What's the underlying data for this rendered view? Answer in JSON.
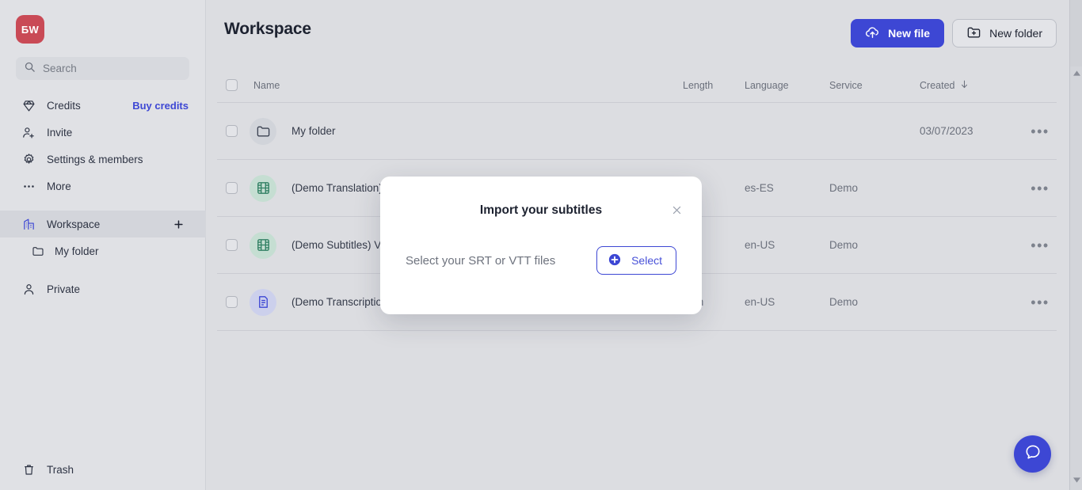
{
  "sidebar": {
    "avatar_initials": "БW",
    "search": {
      "placeholder": "Search",
      "value": ""
    },
    "items": [
      {
        "label": "Credits",
        "icon": "diamond-icon",
        "trailing": "Buy credits"
      },
      {
        "label": "Invite",
        "icon": "user-plus-icon"
      },
      {
        "label": "Settings & members",
        "icon": "gear-icon"
      },
      {
        "label": "More",
        "icon": "ellipsis-icon"
      }
    ],
    "workspace": {
      "label": "Workspace",
      "icon": "building-icon",
      "add_label": "+",
      "active": true
    },
    "workspace_child": {
      "label": "My folder",
      "icon": "folder-icon"
    },
    "private": {
      "label": "Private",
      "icon": "user-icon"
    },
    "trash": {
      "label": "Trash",
      "icon": "trash-icon"
    }
  },
  "header": {
    "title": "Workspace",
    "new_file_label": "New file",
    "new_file_icon": "cloud-upload-icon",
    "new_folder_label": "New folder",
    "new_folder_icon": "folder-plus-icon"
  },
  "table": {
    "columns": [
      "Name",
      "Length",
      "Language",
      "Service",
      "Created"
    ],
    "sort_column": "Created",
    "sort_direction": "down",
    "rows": [
      {
        "icon": "folder-icon",
        "icon_kind": "folder",
        "name": "My folder",
        "length": "",
        "language": "",
        "service": "",
        "created": "03/07/2023",
        "menu": "•••"
      },
      {
        "icon": "film-icon",
        "icon_kind": "video",
        "name": "(Demo Translation) Video",
        "length": "",
        "language": "es-ES",
        "service": "Demo",
        "created": "",
        "menu": "•••"
      },
      {
        "icon": "film-icon",
        "icon_kind": "video",
        "name": "(Demo Subtitles) Video",
        "length": "",
        "language": "en-US",
        "service": "Demo",
        "created": "",
        "menu": "•••"
      },
      {
        "icon": "document-icon",
        "icon_kind": "doc",
        "name": "(Demo Transcription) TED Talk",
        "length": "15m",
        "language": "en-US",
        "service": "Demo",
        "created": "",
        "menu": "•••"
      }
    ]
  },
  "modal": {
    "title": "Import your subtitles",
    "hint": "Select your SRT or VTT files",
    "select_label": "Select",
    "select_icon": "plus-circle-icon",
    "close_icon": "close-icon"
  },
  "help": {
    "icon": "chat-bubble-icon"
  },
  "colors": {
    "accent": "#3d47d4",
    "avatar_bg": "#c94a56",
    "page_bg": "#dcdde1",
    "sidebar_bg": "#e0e1e5",
    "video_icon": "#2f7f62",
    "doc_icon": "#3d47d4"
  }
}
